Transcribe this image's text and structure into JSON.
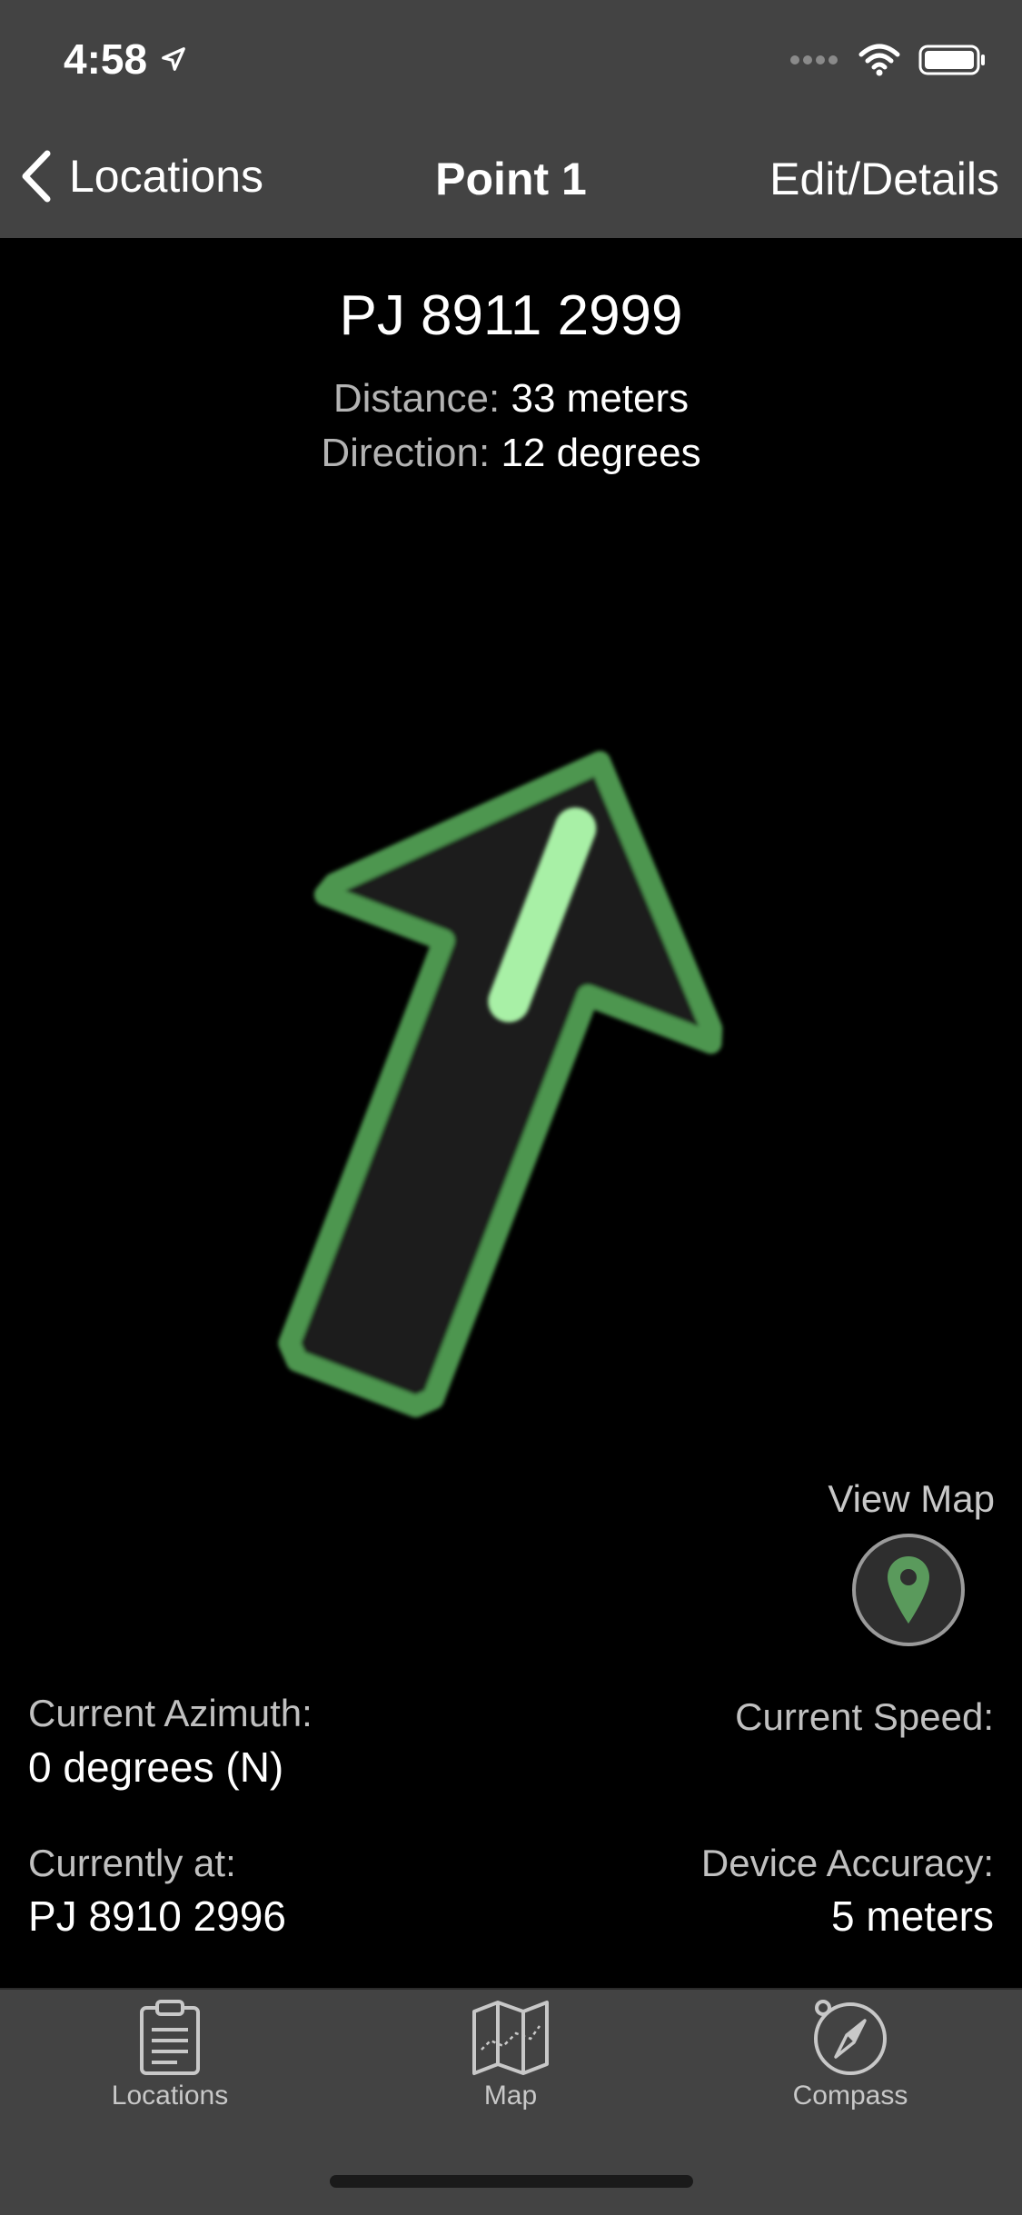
{
  "status_bar": {
    "time": "4:58"
  },
  "nav": {
    "back_label": "Locations",
    "title": "Point 1",
    "edit_label": "Edit/Details"
  },
  "target": {
    "grid_reference": "PJ 8911 2999",
    "distance_label": "Distance:",
    "distance_value": "33 meters",
    "direction_label": "Direction:",
    "direction_value": "12 degrees"
  },
  "view_map": {
    "label": "View Map"
  },
  "readings": {
    "azimuth_label": "Current Azimuth:",
    "azimuth_value": "0 degrees (N)",
    "speed_label": "Current Speed:",
    "current_at_label": "Currently at:",
    "current_at_value": "PJ 8910 2996",
    "accuracy_label": "Device Accuracy:",
    "accuracy_value": "5 meters"
  },
  "tabs": [
    {
      "label": "Locations",
      "icon": "clipboard-icon"
    },
    {
      "label": "Map",
      "icon": "map-icon"
    },
    {
      "label": "Compass",
      "icon": "compass-icon"
    }
  ],
  "colors": {
    "bar_background": "#434343",
    "arrow_outline": "#4e9650",
    "arrow_highlight": "#a8f0a6",
    "pin_green": "#5a9a5c"
  }
}
